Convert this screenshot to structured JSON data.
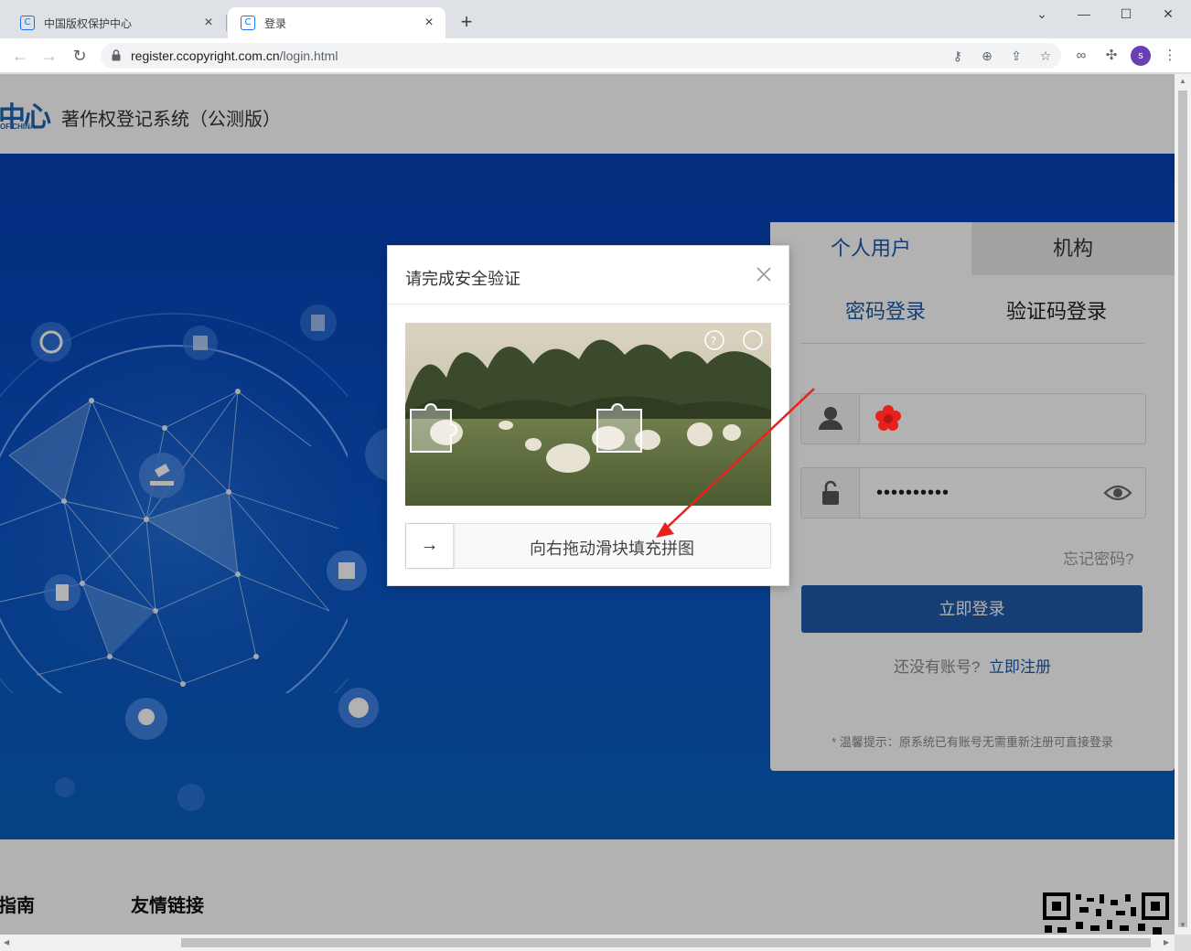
{
  "browser": {
    "tabs": [
      {
        "title": "中国版权保护中心",
        "favicon": "C"
      },
      {
        "title": "登录",
        "favicon": "C"
      }
    ],
    "url_host": "register.ccopyright.com.cn",
    "url_path": "/login.html",
    "profile_initial": "s"
  },
  "site": {
    "logo_text": "中心",
    "logo_sub": "OF CHINA",
    "title": "著作权登记系统（公测版）"
  },
  "login": {
    "tab_personal": "个人用户",
    "tab_org": "机构",
    "sub_password": "密码登录",
    "sub_code": "验证码登录",
    "username_value": "",
    "password_mask": "••••••••••",
    "forgot": "忘记密码?",
    "submit": "立即登录",
    "no_account": "还没有账号?",
    "register": "立即注册",
    "tip": "* 温馨提示：原系统已有账号无需重新注册可直接登录"
  },
  "captcha": {
    "title": "请完成安全验证",
    "slider_text": "向右拖动滑块填充拼图",
    "slider_arrow": "→"
  },
  "footer": {
    "guide": "指南",
    "links": "友情链接"
  },
  "colors": {
    "brand_blue": "#1a5aa8",
    "hero_blue": "#0640b6",
    "annotation_red": "#e8221b"
  }
}
